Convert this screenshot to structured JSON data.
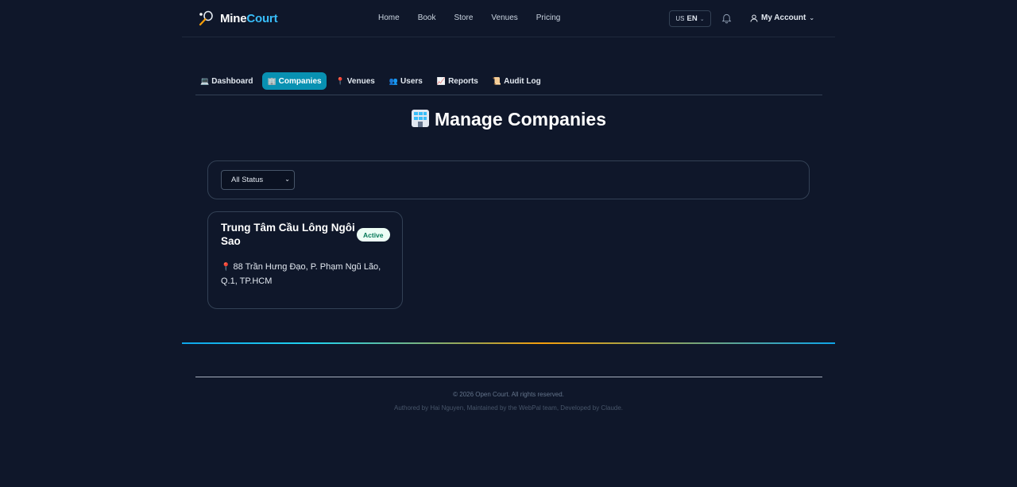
{
  "brand": {
    "name_white": "Mine",
    "name_cyan": "Court"
  },
  "nav": {
    "items": [
      "Home",
      "Book",
      "Store",
      "Venues",
      "Pricing"
    ]
  },
  "language": {
    "flag": "US",
    "code": "EN"
  },
  "account": {
    "label": "My Account"
  },
  "admin_tabs": [
    {
      "label": "Dashboard",
      "icon": "💻"
    },
    {
      "label": "Companies",
      "icon": "🏢"
    },
    {
      "label": "Venues",
      "icon": "📍"
    },
    {
      "label": "Users",
      "icon": "👥"
    },
    {
      "label": "Reports",
      "icon": "📈"
    },
    {
      "label": "Audit Log",
      "icon": "📜"
    }
  ],
  "active_tab": "Companies",
  "page": {
    "title": "Manage Companies",
    "icon": "building-icon"
  },
  "filter": {
    "status_selected": "All Status"
  },
  "companies": [
    {
      "name": "Trung Tâm Cầu Lông Ngôi Sao",
      "status": "Active",
      "address": "88 Trần Hưng Đạo, P. Phạm Ngũ Lão, Q.1, TP.HCM"
    }
  ],
  "footer": {
    "copyright": "© 2026 Open Court. All rights reserved.",
    "credits": "Authored by Hai Nguyen, Maintained by the WebPal team, Developed by Claude."
  },
  "colors": {
    "background": "#0f172a",
    "accent": "#0891b2",
    "brand_cyan": "#38bdf8",
    "active_badge_bg": "#ecfdf5"
  }
}
